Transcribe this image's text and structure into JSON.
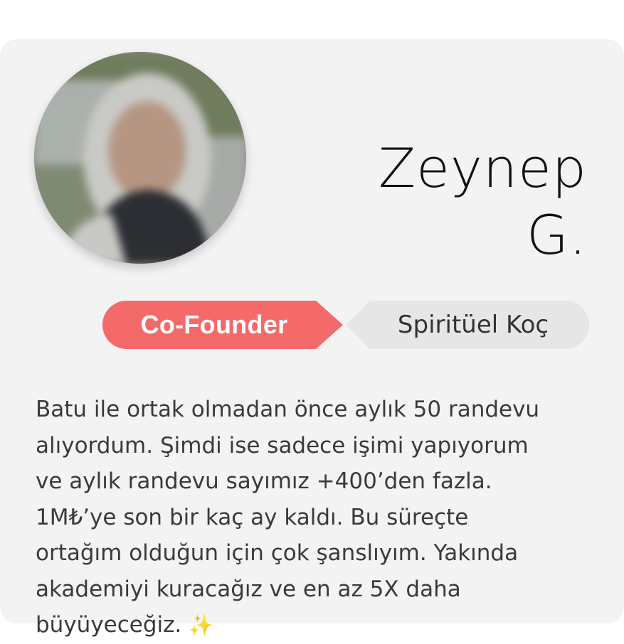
{
  "profile": {
    "name_first": "Zeynep",
    "name_last": "G.",
    "role": "Co-Founder",
    "title": "Spiritüel Koç",
    "photo_icon": "avatar-photo"
  },
  "testimonial": {
    "lines": [
      "Batu ile ortak olmadan önce aylık 50 randevu",
      "alıyordum. Şimdi ise sadece işimi yapıyorum",
      "ve aylık randevu sayımız +400’den fazla.",
      "1M₺’ye son bir kaç ay kaldı. Bu süreçte",
      "ortağım olduğun için çok şanslıyım. Yakında",
      "akademiyi kuracağız ve en az 5X daha",
      "büyüyeceğiz."
    ],
    "emoji": "✨"
  },
  "colors": {
    "card_background": "#f3f3f3",
    "role_badge": "#f46a6a",
    "title_badge": "#e6e6e6",
    "name_text": "#111111",
    "body_text": "#3a3a3a"
  }
}
